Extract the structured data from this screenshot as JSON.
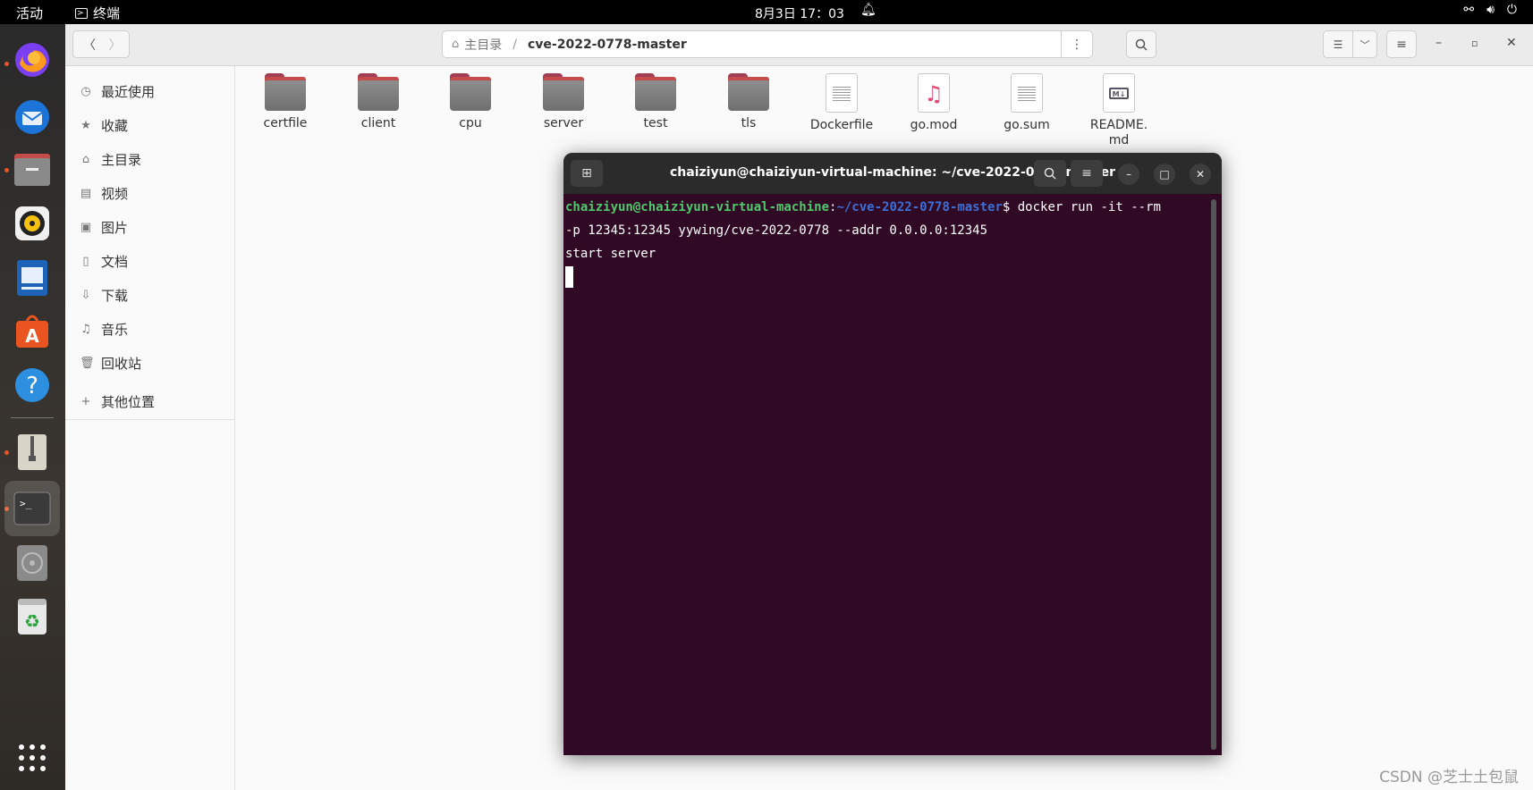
{
  "topbar": {
    "activities": "活动",
    "app_name": "终端",
    "clock": "8月3日  17：03"
  },
  "dock": {
    "items": [
      "firefox-icon",
      "thunderbird-icon",
      "files-icon",
      "rhythmbox-icon",
      "writer-icon",
      "software-icon",
      "help-icon",
      "archive-icon",
      "terminal-icon",
      "disc-icon",
      "trash-icon",
      "apps-grid-icon"
    ]
  },
  "files": {
    "path_home": "主目录",
    "path_current": "cve-2022-0778-master",
    "sidebar": [
      {
        "icon": "clock-icon",
        "label": "最近使用"
      },
      {
        "icon": "star-icon",
        "label": "收藏"
      },
      {
        "icon": "home-icon",
        "label": "主目录"
      },
      {
        "icon": "video-icon",
        "label": "视频"
      },
      {
        "icon": "image-icon",
        "label": "图片"
      },
      {
        "icon": "document-icon",
        "label": "文档"
      },
      {
        "icon": "download-icon",
        "label": "下载"
      },
      {
        "icon": "music-icon",
        "label": "音乐"
      },
      {
        "icon": "trash-icon",
        "label": "回收站"
      },
      {
        "icon": "plus-icon",
        "label": "其他位置"
      }
    ],
    "items": [
      {
        "name": "certfile",
        "type": "folder"
      },
      {
        "name": "client",
        "type": "folder"
      },
      {
        "name": "cpu",
        "type": "folder"
      },
      {
        "name": "server",
        "type": "folder"
      },
      {
        "name": "test",
        "type": "folder"
      },
      {
        "name": "tls",
        "type": "folder"
      },
      {
        "name": "Dockerfile",
        "type": "text"
      },
      {
        "name": "go.mod",
        "type": "audio"
      },
      {
        "name": "go.sum",
        "type": "text"
      },
      {
        "name": "README.\nmd",
        "type": "markdown"
      }
    ]
  },
  "terminal": {
    "title": "chaiziyun@chaiziyun-virtual-machine: ~/cve-2022-0778-master",
    "prompt_user": "chaiziyun@chaiziyun-virtual-machine",
    "prompt_colon": ":",
    "prompt_path": "~/cve-2022-0778-master",
    "prompt_symbol": "$",
    "command_line1": " docker run -it --rm",
    "command_line2": "-p 12345:12345 yywing/cve-2022-0778 --addr 0.0.0.0:12345",
    "output": "start server"
  },
  "watermark": "CSDN @芝士土包鼠"
}
